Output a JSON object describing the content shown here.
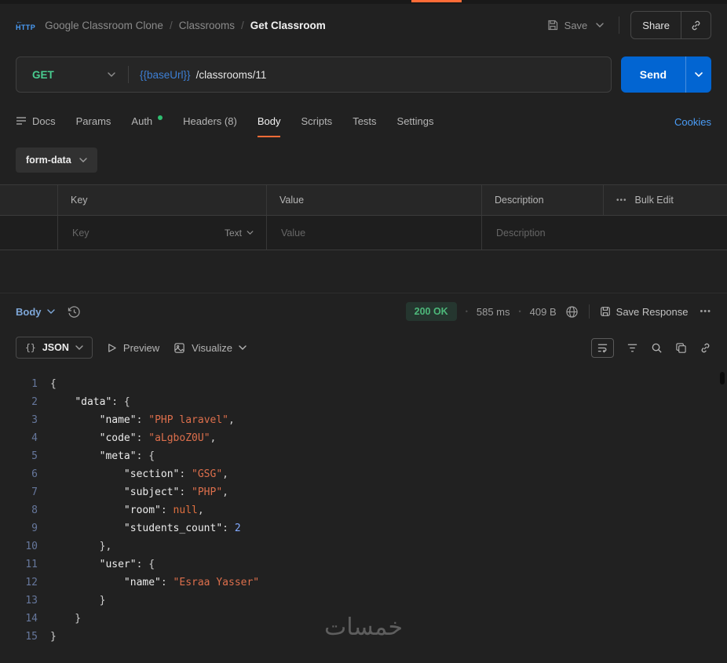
{
  "chrome": {
    "accent": "#ff6c37"
  },
  "header": {
    "http_label": "HTTP",
    "breadcrumb": {
      "app": "Google Classroom Clone",
      "sep": "/",
      "collection": "Classrooms",
      "current": "Get Classroom"
    },
    "save_label": "Save",
    "share_label": "Share"
  },
  "request": {
    "method": "GET",
    "url_variable": "{{baseUrl}}",
    "url_path": "/classrooms/11",
    "send_label": "Send"
  },
  "tabs": {
    "docs": "Docs",
    "params": "Params",
    "auth": "Auth",
    "headers": "Headers (8)",
    "body": "Body",
    "scripts": "Scripts",
    "tests": "Tests",
    "settings": "Settings",
    "cookies_link": "Cookies"
  },
  "body_editor": {
    "type_label": "form-data",
    "table": {
      "key_header": "Key",
      "value_header": "Value",
      "desc_header": "Description",
      "more_dots": "•••",
      "bulk_edit_label": "Bulk Edit",
      "row": {
        "key_placeholder": "Key",
        "type_label": "Text",
        "value_placeholder": "Value",
        "desc_placeholder": "Description"
      }
    }
  },
  "response": {
    "body_label": "Body",
    "status": "200 OK",
    "dot": "•",
    "time": "585 ms",
    "size": "409 B",
    "save_response_label": "Save Response",
    "more_dots": "•••",
    "views": {
      "json_icon": "{}",
      "json_label": "JSON",
      "preview_label": "Preview",
      "visualize_label": "Visualize"
    }
  },
  "code": {
    "lines": [
      {
        "n": "1",
        "tokens": [
          [
            "p",
            "{"
          ]
        ]
      },
      {
        "n": "2",
        "tokens": [
          [
            "p",
            "    "
          ],
          [
            "k",
            "\"data\""
          ],
          [
            "p",
            ": {"
          ]
        ]
      },
      {
        "n": "3",
        "tokens": [
          [
            "p",
            "        "
          ],
          [
            "k",
            "\"name\""
          ],
          [
            "p",
            ": "
          ],
          [
            "s",
            "\"PHP laravel\""
          ],
          [
            "p",
            ","
          ]
        ]
      },
      {
        "n": "4",
        "tokens": [
          [
            "p",
            "        "
          ],
          [
            "k",
            "\"code\""
          ],
          [
            "p",
            ": "
          ],
          [
            "s",
            "\"aLgboZ0U\""
          ],
          [
            "p",
            ","
          ]
        ]
      },
      {
        "n": "5",
        "tokens": [
          [
            "p",
            "        "
          ],
          [
            "k",
            "\"meta\""
          ],
          [
            "p",
            ": {"
          ]
        ]
      },
      {
        "n": "6",
        "tokens": [
          [
            "p",
            "            "
          ],
          [
            "k",
            "\"section\""
          ],
          [
            "p",
            ": "
          ],
          [
            "s",
            "\"GSG\""
          ],
          [
            "p",
            ","
          ]
        ]
      },
      {
        "n": "7",
        "tokens": [
          [
            "p",
            "            "
          ],
          [
            "k",
            "\"subject\""
          ],
          [
            "p",
            ": "
          ],
          [
            "s",
            "\"PHP\""
          ],
          [
            "p",
            ","
          ]
        ]
      },
      {
        "n": "8",
        "tokens": [
          [
            "p",
            "            "
          ],
          [
            "k",
            "\"room\""
          ],
          [
            "p",
            ": "
          ],
          [
            "u",
            "null"
          ],
          [
            "p",
            ","
          ]
        ]
      },
      {
        "n": "9",
        "tokens": [
          [
            "p",
            "            "
          ],
          [
            "k",
            "\"students_count\""
          ],
          [
            "p",
            ": "
          ],
          [
            "d",
            "2"
          ]
        ]
      },
      {
        "n": "10",
        "tokens": [
          [
            "p",
            "        },"
          ]
        ]
      },
      {
        "n": "11",
        "tokens": [
          [
            "p",
            "        "
          ],
          [
            "k",
            "\"user\""
          ],
          [
            "p",
            ": {"
          ]
        ]
      },
      {
        "n": "12",
        "tokens": [
          [
            "p",
            "            "
          ],
          [
            "k",
            "\"name\""
          ],
          [
            "p",
            ": "
          ],
          [
            "s",
            "\"Esraa Yasser\""
          ]
        ]
      },
      {
        "n": "13",
        "tokens": [
          [
            "p",
            "        }"
          ]
        ]
      },
      {
        "n": "14",
        "tokens": [
          [
            "p",
            "    }"
          ]
        ]
      },
      {
        "n": "15",
        "tokens": [
          [
            "p",
            "}"
          ]
        ]
      }
    ]
  },
  "watermark": "خمسات",
  "colors": {
    "accent_orange": "#ff6c37",
    "method_get_green": "#49cc90",
    "send_blue": "#0265d2",
    "status_green": "#4db87a",
    "link_blue": "#4a9df8",
    "json_string_orange": "#dd6f4c",
    "json_number_blue": "#82aaff"
  }
}
